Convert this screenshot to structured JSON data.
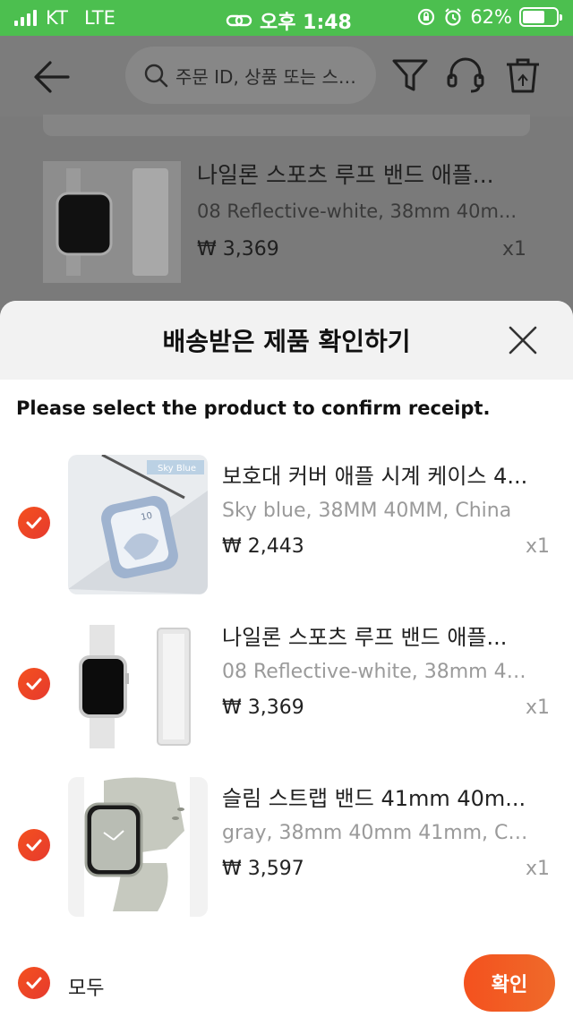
{
  "status_bar": {
    "carrier": "KT",
    "network": "LTE",
    "time": "오후 1:48",
    "battery": "62%"
  },
  "background": {
    "search_placeholder": "주문 ID, 상품 또는 스…",
    "item": {
      "title": "나일론 스포츠 루프 밴드 애플...",
      "variant": "08 Reflective-white, 38mm 40m...",
      "price": "₩ 3,369",
      "qty": "x1"
    }
  },
  "sheet": {
    "title": "배송받은 제품 확인하기",
    "instruction": "Please select the product to confirm receipt.",
    "items": [
      {
        "title": "보호대 커버 애플 시계 케이스 4...",
        "variant": "Sky blue, 38MM 40MM, China",
        "price": "₩ 2,443",
        "qty": "x1",
        "thumb_label": "Sky Blue",
        "checked": true
      },
      {
        "title": "나일론 스포츠 루프 밴드 애플...",
        "variant": "08 Reflective-white, 38mm 40...",
        "price": "₩ 3,369",
        "qty": "x1",
        "checked": true
      },
      {
        "title": "슬림 스트랩 밴드 41mm 40m...",
        "variant": "gray, 38mm 40mm 41mm, China",
        "price": "₩ 3,597",
        "qty": "x1",
        "checked": true
      }
    ],
    "select_all_label": "모두",
    "confirm_label": "확인"
  },
  "colors": {
    "accent": "#f4511e",
    "status_bar": "#4cbf4f"
  }
}
